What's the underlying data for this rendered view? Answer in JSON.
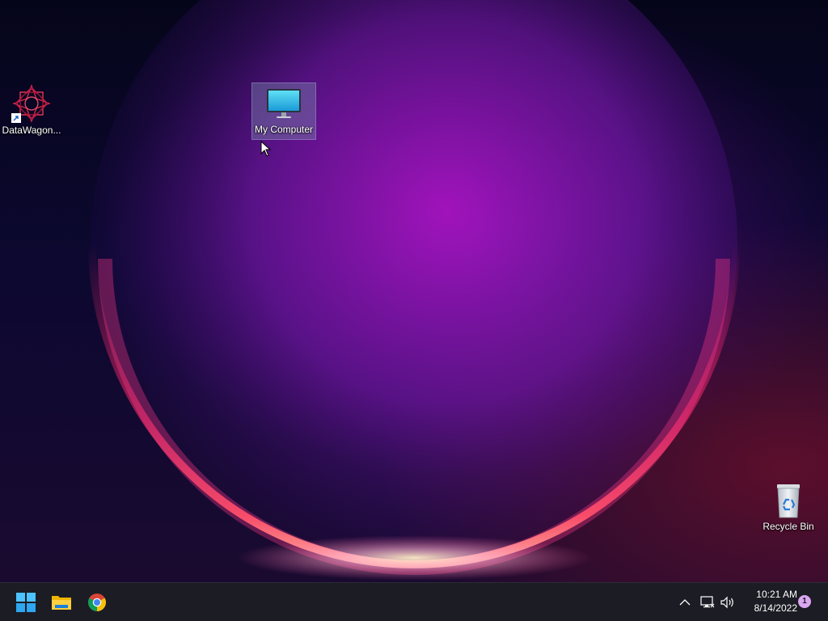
{
  "desktop": {
    "icons": [
      {
        "label": "DataWagon...",
        "icon": "datawagon-app-icon",
        "shortcut": true
      },
      {
        "label": "My Computer",
        "icon": "monitor-icon",
        "selected": true
      },
      {
        "label": "Recycle Bin",
        "icon": "recycle-bin-icon"
      }
    ]
  },
  "taskbar": {
    "pinned": [
      {
        "icon": "windows-start-icon"
      },
      {
        "icon": "file-explorer-icon"
      },
      {
        "icon": "chrome-icon"
      }
    ],
    "tray": {
      "icons": [
        "chevron-up-icon",
        "network-icon",
        "volume-icon"
      ],
      "time": "10:21 AM",
      "date": "8/14/2022",
      "notification_count": "1"
    }
  },
  "colors": {
    "taskbar_bg": "#1c1c24",
    "badge": "#d9a6f0"
  }
}
